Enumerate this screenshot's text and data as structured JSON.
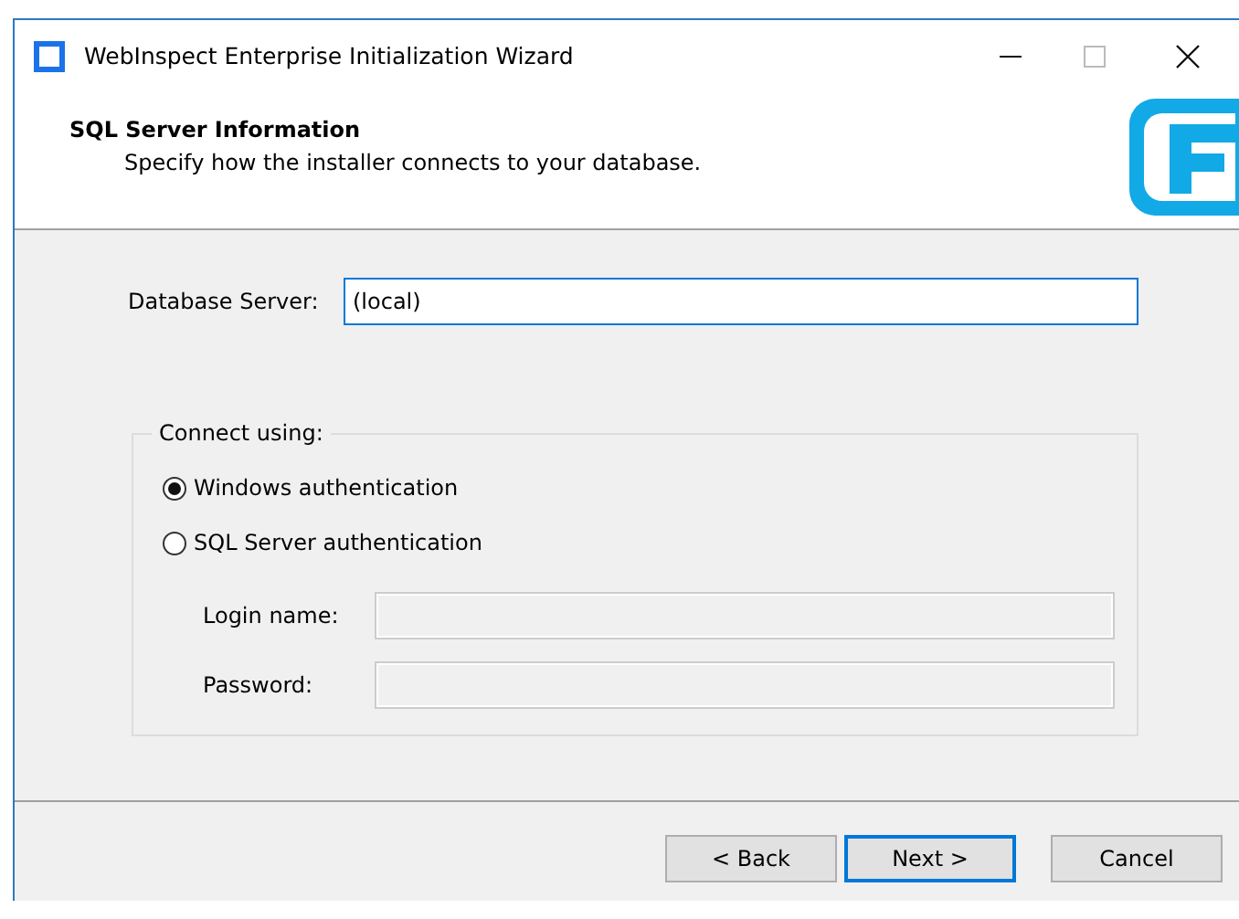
{
  "window": {
    "title": "WebInspect Enterprise Initialization Wizard"
  },
  "header": {
    "title": "SQL Server Information",
    "subtitle": "Specify how the installer connects to your database."
  },
  "server": {
    "label": "Database Server:",
    "value": "(local)"
  },
  "connect": {
    "legend": "Connect using:",
    "options": [
      {
        "label": "Windows authentication",
        "selected": true
      },
      {
        "label": "SQL Server authentication",
        "selected": false
      }
    ],
    "fields": [
      {
        "label": "Login name:",
        "disabled": true
      },
      {
        "label": "Password:",
        "disabled": true
      }
    ]
  },
  "buttons": [
    {
      "label": "< Back",
      "default": false
    },
    {
      "label": "Next >",
      "default": true
    },
    {
      "label": "Cancel",
      "default": false
    }
  ]
}
